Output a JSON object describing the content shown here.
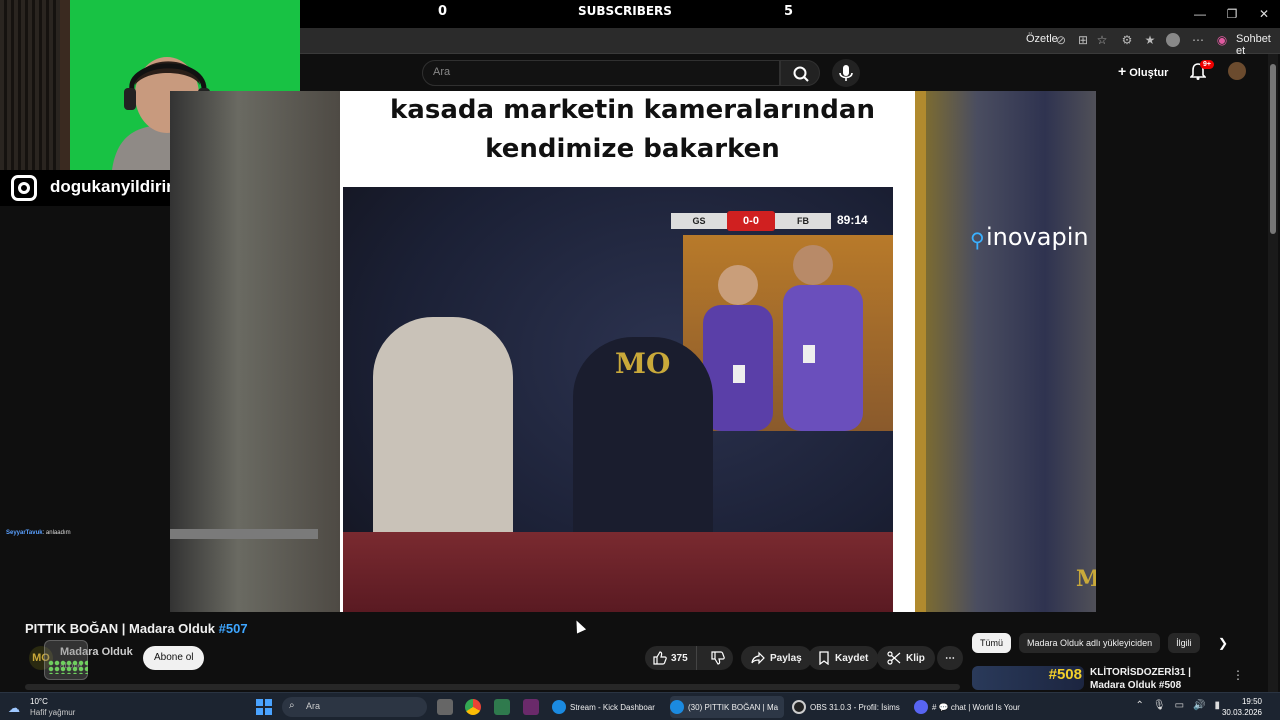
{
  "overlay": {
    "left_count": "0",
    "title": "SUBSCRIBERS",
    "right_count": "5"
  },
  "browser": {
    "summarize_label": "Özetle",
    "chat_label": "Sohbet et"
  },
  "youtube_header": {
    "search_placeholder": "Ara",
    "create_label": "Oluştur",
    "notification_badge": "9+"
  },
  "webcam": {
    "instagram_handle": "dogukanyildirimofficiall"
  },
  "chat": {
    "user": "SeyyarTavuk",
    "message": ": anlaadım"
  },
  "video": {
    "caption": "kasada marketin kameralarından kendimize bakarken",
    "score_home": "GS",
    "score_value": "0-0",
    "score_away": "FB",
    "match_time": "89:14",
    "watermark": "MO",
    "sponsor": "inovapin"
  },
  "info": {
    "title": "PITTIK BOĞAN | Madara Olduk",
    "title_tag": "#507",
    "channel_name": "Madara Olduk",
    "subscriber_text": "abone",
    "channel_avatar_text": "MO",
    "subscribe_label": "Abone ol",
    "like_count": "375",
    "share_label": "Paylaş",
    "save_label": "Kaydet",
    "clip_label": "Klip"
  },
  "sidebar": {
    "chips": [
      "Tümü",
      "Madara Olduk adlı yükleyiciden",
      "İlgili"
    ],
    "rec_thumb_num": "#508",
    "rec_title": "KLİTORİSDOZERİ31 | Madara Olduk #508"
  },
  "taskbar": {
    "temp": "10°C",
    "weather_desc": "Hafif yağmur",
    "search_placeholder": "Ara",
    "tasks": [
      "Stream - Kick Dashboar",
      "(30) PITTIK BOĞAN | Ma",
      "OBS 31.0.3 - Profil: İsims",
      "# 💬 chat | World Is Your"
    ],
    "time": "19:50",
    "date": "30.03.2026"
  },
  "colors": {
    "accent_blue": "#3ea6ff",
    "youtube_bg": "#0f0f0f",
    "score_red": "#d02020"
  }
}
